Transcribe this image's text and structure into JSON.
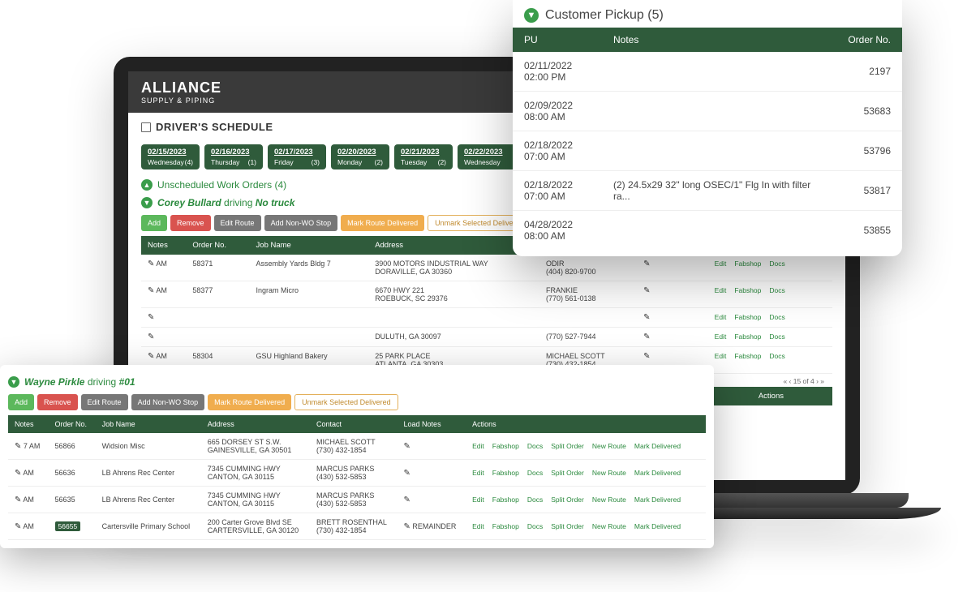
{
  "brand": {
    "name": "ALLIANCE",
    "sub": "SUPPLY & PIPING"
  },
  "page": {
    "title": "DRIVER'S SCHEDULE"
  },
  "dates": [
    {
      "date": "02/15/2023",
      "day": "Wednesday",
      "count": "(4)"
    },
    {
      "date": "02/16/2023",
      "day": "Thursday",
      "count": "(1)"
    },
    {
      "date": "02/17/2023",
      "day": "Friday",
      "count": "(3)"
    },
    {
      "date": "02/20/2023",
      "day": "Monday",
      "count": "(2)"
    },
    {
      "date": "02/21/2023",
      "day": "Tuesday",
      "count": "(2)"
    },
    {
      "date": "02/22/2023",
      "day": "Wednesday",
      "count": ""
    }
  ],
  "unscheduled": {
    "label": "Unscheduled Work Orders (4)"
  },
  "driver_main": {
    "name": "Corey Bullard",
    "driving": "driving",
    "truck": "No truck"
  },
  "buttons": {
    "add": "Add",
    "remove": "Remove",
    "edit_route": "Edit Route",
    "add_non": "Add Non-WO Stop",
    "mark": "Mark Route Delivered",
    "unmark": "Unmark Selected Delivered"
  },
  "main_cols": [
    "Notes",
    "Order No.",
    "Job Name",
    "Address",
    "Contact",
    "Load Notes",
    "Actions"
  ],
  "main_rows": [
    {
      "notes": "AM",
      "order": "58371",
      "job": "Assembly Yards Bldg 7",
      "addr1": "3900 MOTORS INDUSTRIAL WAY",
      "addr2": "DORAVILLE, GA 30360",
      "contact1": "ODIR",
      "contact2": "(404) 820-9700"
    },
    {
      "notes": "AM",
      "order": "58377",
      "job": "Ingram Micro",
      "addr1": "6670 HWY 221",
      "addr2": "ROEBUCK, SC 29376",
      "contact1": "FRANKIE",
      "contact2": "(770) 561-0138"
    },
    {
      "notes": "",
      "order": "",
      "job": "",
      "addr1": "",
      "addr2": "",
      "contact1": "",
      "contact2": ""
    },
    {
      "notes": "",
      "order": "",
      "job": "",
      "addr1": "DULUTH, GA 30097",
      "addr2": "",
      "contact1": "",
      "contact2": "(770) 527-7944"
    },
    {
      "notes": "AM",
      "order": "58304",
      "job": "GSU Highland Bakery",
      "addr1": "25 PARK PLACE",
      "addr2": "ATLANTA, GA 30303",
      "contact1": "MICHAEL SCOTT",
      "contact2": "(730) 432-1854"
    }
  ],
  "action_links": {
    "edit": "Edit",
    "fabshop": "Fabshop",
    "docs": "Docs",
    "split": "Split Order",
    "new_route": "New Route",
    "mark_del": "Mark Delivered"
  },
  "pager": {
    "text": "15 of 4"
  },
  "pickup": {
    "title": "Customer Pickup (5)",
    "cols": [
      "PU",
      "Notes",
      "Order No."
    ],
    "rows": [
      {
        "d": "02/11/2022",
        "t": "02:00 PM",
        "n": "",
        "o": "2197"
      },
      {
        "d": "02/09/2022",
        "t": "08:00 AM",
        "n": "",
        "o": "53683"
      },
      {
        "d": "02/18/2022",
        "t": "07:00 AM",
        "n": "",
        "o": "53796"
      },
      {
        "d": "02/18/2022",
        "t": "07:00 AM",
        "n": "(2) 24.5x29 32\" long OSEC/1\" Flg In with filter ra...",
        "o": "53817"
      },
      {
        "d": "04/28/2022",
        "t": "08:00 AM",
        "n": "",
        "o": "53855"
      }
    ]
  },
  "driver2": {
    "name": "Wayne Pirkle",
    "driving": "driving",
    "truck": "#01",
    "cols": [
      "Notes",
      "Order No.",
      "Job Name",
      "Address",
      "Contact",
      "Load Notes",
      "Actions"
    ],
    "rows": [
      {
        "notes": "7 AM",
        "order": "56866",
        "job": "Widsion Misc",
        "addr1": "665 DORSEY ST S.W.",
        "addr2": "GAINESVILLE, GA 30501",
        "contact1": "MICHAEL SCOTT",
        "contact2": "(730) 432-1854",
        "ln": ""
      },
      {
        "notes": "AM",
        "order": "56636",
        "job": "LB Ahrens Rec Center",
        "addr1": "7345 CUMMING HWY",
        "addr2": "CANTON, GA 30115",
        "contact1": "MARCUS PARKS",
        "contact2": "(430) 532-5853",
        "ln": ""
      },
      {
        "notes": "AM",
        "order": "56635",
        "job": "LB Ahrens Rec Center",
        "addr1": "7345 CUMMING HWY",
        "addr2": "CANTON, GA 30115",
        "contact1": "MARCUS PARKS",
        "contact2": "(430) 532-5853",
        "ln": ""
      },
      {
        "notes": "AM",
        "order": "56655",
        "job": "Cartersville Primary School",
        "addr1": "200 Carter Grove Blvd SE",
        "addr2": "CARTERSVILLE, GA 30120",
        "contact1": "BRETT ROSENTHAL",
        "contact2": "(730) 432-1854",
        "ln": "REMAINDER",
        "badge": true
      }
    ]
  }
}
